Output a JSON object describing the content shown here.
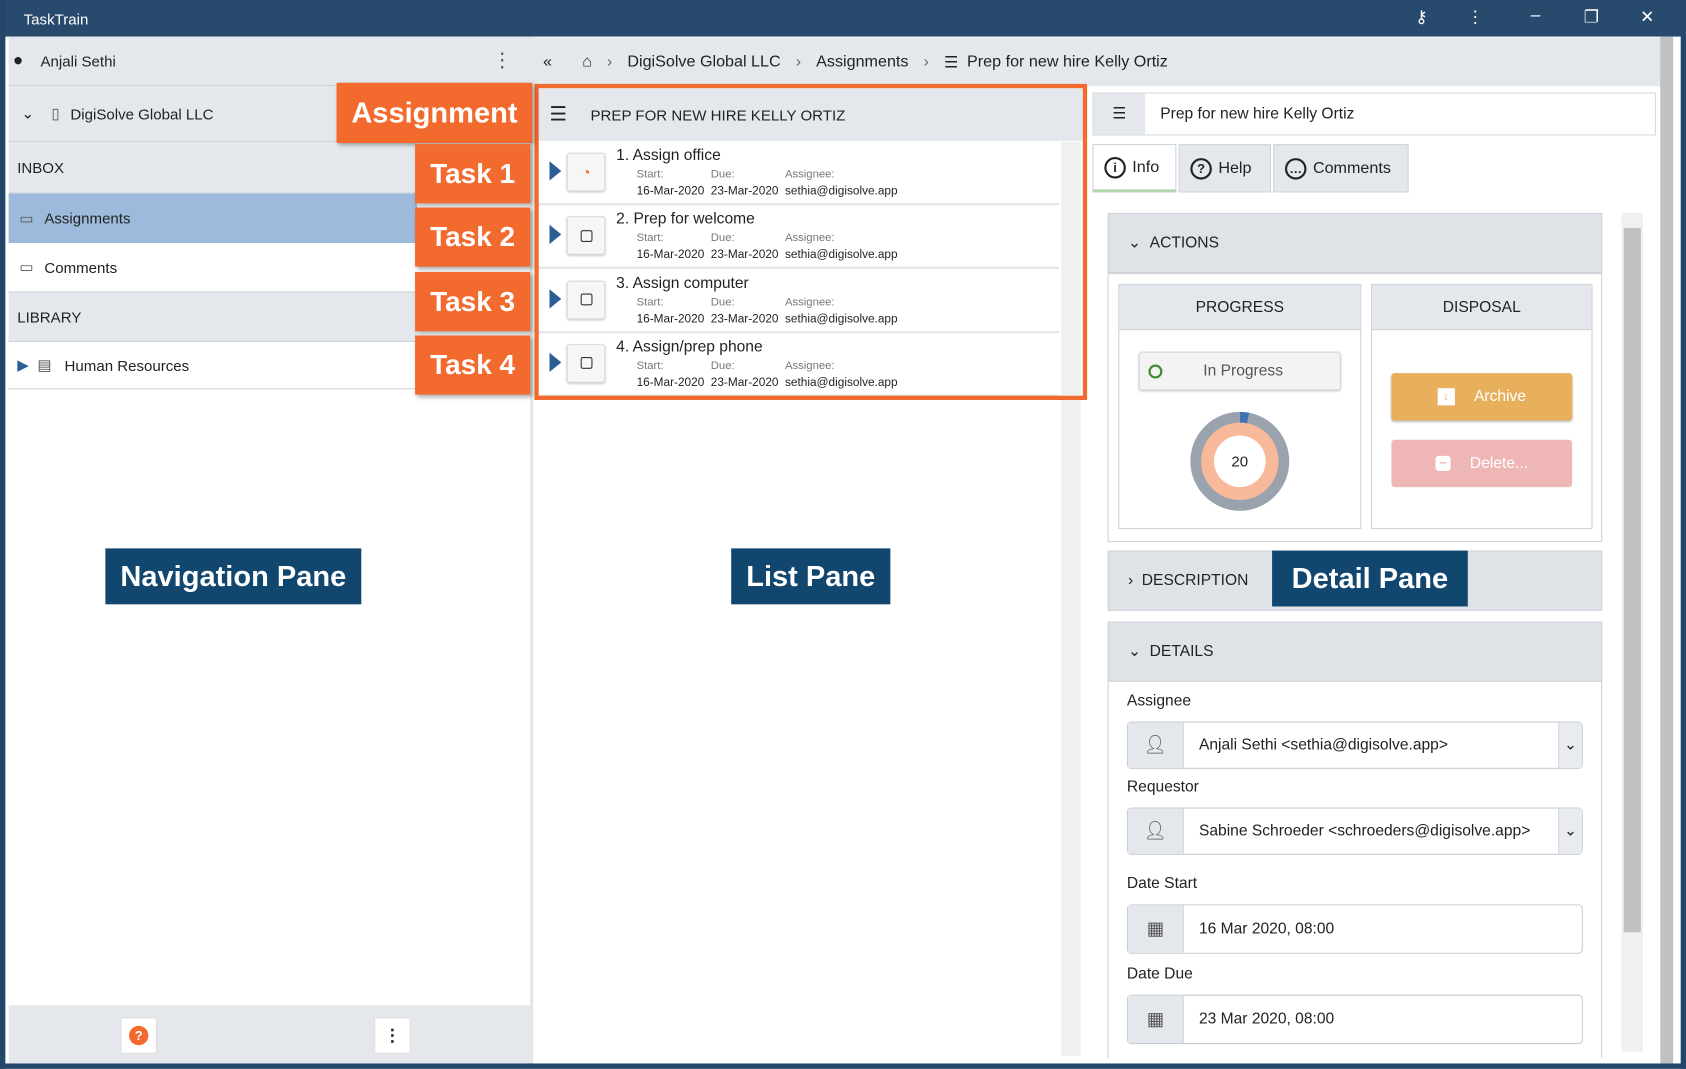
{
  "app": {
    "title": "TaskTrain"
  },
  "nav": {
    "user": "Anjali Sethi",
    "org": "DigiSolve Global LLC",
    "inbox_header": "INBOX",
    "items": [
      {
        "label": "Assignments"
      },
      {
        "label": "Comments"
      }
    ],
    "library_header": "LIBRARY",
    "library_items": [
      {
        "label": "Human Resources"
      }
    ]
  },
  "breadcrumb": [
    "DigiSolve Global LLC",
    "Assignments",
    "Prep for new hire Kelly Ortiz"
  ],
  "list": {
    "title": "PREP FOR NEW HIRE KELLY ORTIZ",
    "labels": {
      "start": "Start:",
      "due": "Due:",
      "assignee": "Assignee:"
    },
    "tasks": [
      {
        "name": "1.  Assign office",
        "start": "16-Mar-2020",
        "due": "23-Mar-2020",
        "assignee": "sethia@digisolve.app"
      },
      {
        "name": "2.  Prep for welcome",
        "start": "16-Mar-2020",
        "due": "23-Mar-2020",
        "assignee": "sethia@digisolve.app"
      },
      {
        "name": "3.  Assign computer",
        "start": "16-Mar-2020",
        "due": "23-Mar-2020",
        "assignee": "sethia@digisolve.app"
      },
      {
        "name": "4.  Assign/prep phone",
        "start": "16-Mar-2020",
        "due": "23-Mar-2020",
        "assignee": "sethia@digisolve.app"
      }
    ]
  },
  "detail": {
    "title": "Prep for new hire Kelly Ortiz",
    "tabs": [
      "Info",
      "Help",
      "Comments"
    ],
    "actions": "ACTIONS",
    "progress_header": "PROGRESS",
    "disposal_header": "DISPOSAL",
    "status": "In Progress",
    "progress_value": "20",
    "progress_percent": 20,
    "archive": "Archive",
    "delete": "Delete...",
    "description": "DESCRIPTION",
    "details": "DETAILS",
    "assignee_label": "Assignee",
    "assignee": "Anjali Sethi <sethia@digisolve.app>",
    "requestor_label": "Requestor",
    "requestor": "Sabine Schroeder <schroeders@digisolve.app>",
    "date_start_label": "Date Start",
    "date_start": "16 Mar 2020, 08:00",
    "date_due_label": "Date Due",
    "date_due": "23 Mar 2020, 08:00"
  },
  "annotations": {
    "assignment": "Assignment",
    "tasks": [
      "Task 1",
      "Task 2",
      "Task 3",
      "Task 4"
    ],
    "nav_pane": "Navigation Pane",
    "list_pane": "List Pane",
    "detail_pane": "Detail Pane"
  },
  "colors": {
    "titlebar": "#274a6d",
    "annotation_orange": "#f26a2e",
    "annotation_navy": "#11466f",
    "archive": "#e8b05c",
    "delete": "#efb6b6",
    "selected": "#9dbadc"
  }
}
